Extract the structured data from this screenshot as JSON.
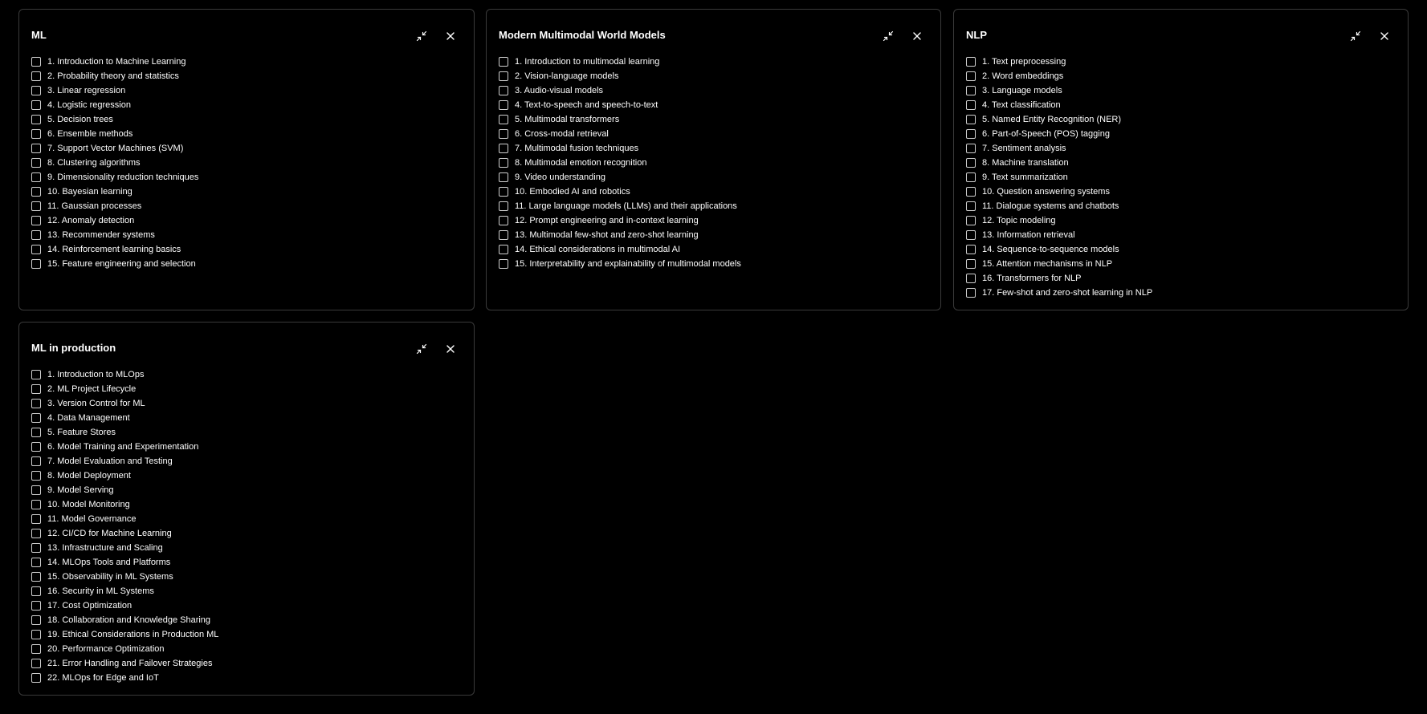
{
  "colors": {
    "background": "#000000",
    "panel_border": "#3a3a3a",
    "text": "#ffffff",
    "checkbox_border": "#cfcfcf"
  },
  "icons": {
    "minimize": "minimize-arrows-icon",
    "close": "close-icon"
  },
  "panels": [
    {
      "title": "ML",
      "items": [
        "1. Introduction to Machine Learning",
        "2. Probability theory and statistics",
        "3. Linear regression",
        "4. Logistic regression",
        "5. Decision trees",
        "6. Ensemble methods",
        "7. Support Vector Machines (SVM)",
        "8. Clustering algorithms",
        "9. Dimensionality reduction techniques",
        "10. Bayesian learning",
        "11. Gaussian processes",
        "12. Anomaly detection",
        "13. Recommender systems",
        "14. Reinforcement learning basics",
        "15. Feature engineering and selection"
      ]
    },
    {
      "title": "Modern Multimodal World Models",
      "items": [
        "1. Introduction to multimodal learning",
        "2. Vision-language models",
        "3. Audio-visual models",
        "4. Text-to-speech and speech-to-text",
        "5. Multimodal transformers",
        "6. Cross-modal retrieval",
        "7. Multimodal fusion techniques",
        "8. Multimodal emotion recognition",
        "9. Video understanding",
        "10. Embodied AI and robotics",
        "11. Large language models (LLMs) and their applications",
        "12. Prompt engineering and in-context learning",
        "13. Multimodal few-shot and zero-shot learning",
        "14. Ethical considerations in multimodal AI",
        "15. Interpretability and explainability of multimodal models"
      ]
    },
    {
      "title": "NLP",
      "items": [
        "1. Text preprocessing",
        "2. Word embeddings",
        "3. Language models",
        "4. Text classification",
        "5. Named Entity Recognition (NER)",
        "6. Part-of-Speech (POS) tagging",
        "7. Sentiment analysis",
        "8. Machine translation",
        "9. Text summarization",
        "10. Question answering systems",
        "11. Dialogue systems and chatbots",
        "12. Topic modeling",
        "13. Information retrieval",
        "14. Sequence-to-sequence models",
        "15. Attention mechanisms in NLP",
        "16. Transformers for NLP",
        "17. Few-shot and zero-shot learning in NLP"
      ]
    },
    {
      "title": "ML in production",
      "items": [
        "1. Introduction to MLOps",
        "2. ML Project Lifecycle",
        "3. Version Control for ML",
        "4. Data Management",
        "5. Feature Stores",
        "6. Model Training and Experimentation",
        "7. Model Evaluation and Testing",
        "8. Model Deployment",
        "9. Model Serving",
        "10. Model Monitoring",
        "11. Model Governance",
        "12. CI/CD for Machine Learning",
        "13. Infrastructure and Scaling",
        "14. MLOps Tools and Platforms",
        "15. Observability in ML Systems",
        "16. Security in ML Systems",
        "17. Cost Optimization",
        "18. Collaboration and Knowledge Sharing",
        "19. Ethical Considerations in Production ML",
        "20. Performance Optimization",
        "21. Error Handling and Failover Strategies",
        "22. MLOps for Edge and IoT"
      ]
    }
  ]
}
